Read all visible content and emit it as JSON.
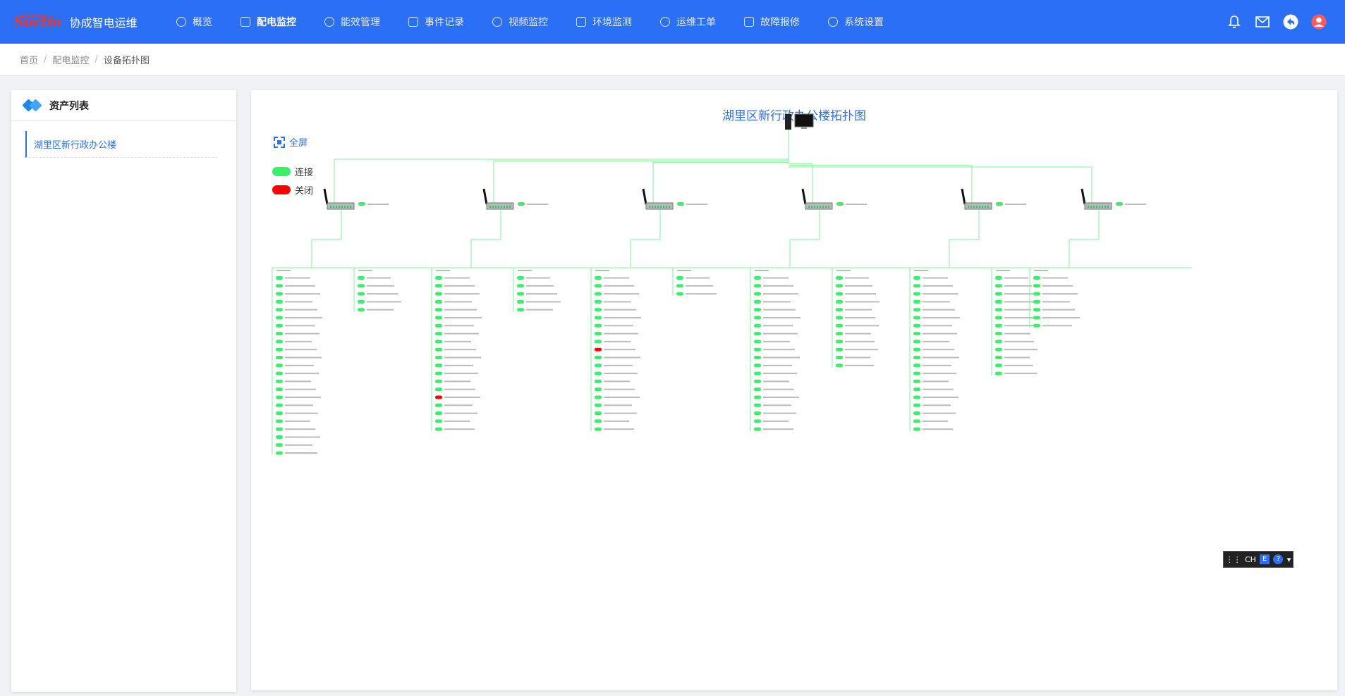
{
  "app": {
    "logo_text": "Suctm",
    "title": "协成智电运维"
  },
  "nav": [
    {
      "label": "概览",
      "active": false
    },
    {
      "label": "配电监控",
      "active": true
    },
    {
      "label": "能效管理",
      "active": false
    },
    {
      "label": "事件记录",
      "active": false
    },
    {
      "label": "视频监控",
      "active": false
    },
    {
      "label": "环境监测",
      "active": false
    },
    {
      "label": "运维工单",
      "active": false
    },
    {
      "label": "故障报修",
      "active": false
    },
    {
      "label": "系统设置",
      "active": false
    }
  ],
  "breadcrumb": [
    "首页",
    "配电监控",
    "设备拓扑图"
  ],
  "sidebar": {
    "title": "资产列表",
    "items": [
      "湖里区新行政办公楼"
    ]
  },
  "diagram": {
    "title": "湖里区新行政办公楼拓扑图",
    "fullscreen_label": "全屏",
    "legend": [
      {
        "label": "连接",
        "color": "#39f06a"
      },
      {
        "label": "关闭",
        "color": "#ff0000"
      }
    ],
    "status_colors": {
      "connected": "#39f06a",
      "closed": "#ff0000",
      "line": "#7ef59a"
    },
    "groups": [
      {
        "col_a": 23,
        "col_b": 5,
        "off_a": [],
        "off_b": []
      },
      {
        "col_a": 20,
        "col_b": 5,
        "off_a": [
          15
        ],
        "off_b": []
      },
      {
        "col_a": 20,
        "col_b": 3,
        "off_a": [
          9
        ],
        "off_b": []
      },
      {
        "col_a": 20,
        "col_b": 12,
        "off_a": [],
        "off_b": []
      },
      {
        "col_a": 20,
        "col_b": 13,
        "off_a": [],
        "off_b": []
      },
      {
        "col_a": 7,
        "col_b": 0,
        "off_a": [],
        "off_b": []
      }
    ]
  },
  "ime": {
    "lang": "CH"
  }
}
